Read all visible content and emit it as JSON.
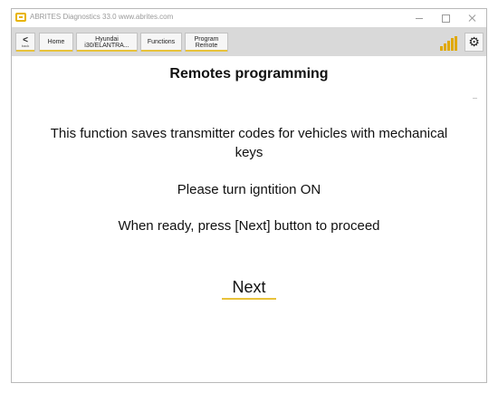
{
  "window": {
    "title": "ABRITES Diagnostics 33.0   www.abrites.com"
  },
  "toolbar": {
    "back_chevron": "<",
    "back_label": "back",
    "breadcrumb": [
      {
        "line1": "Home",
        "line2": ""
      },
      {
        "line1": "Hyundai",
        "line2": "i30/ELANTRA..."
      },
      {
        "line1": "Functions",
        "line2": ""
      },
      {
        "line1": "Program",
        "line2": "Remote"
      }
    ],
    "signal_icon": "signal-bars-icon",
    "settings_icon": "gear-icon",
    "accent_color": "#e8c23a"
  },
  "main": {
    "title": "Remotes programming",
    "message_1": "This function saves transmitter codes for vehicles with mechanical keys",
    "message_2": "Please turn igntition ON",
    "message_3": "When ready, press [Next] button to proceed",
    "next_label": "Next"
  }
}
